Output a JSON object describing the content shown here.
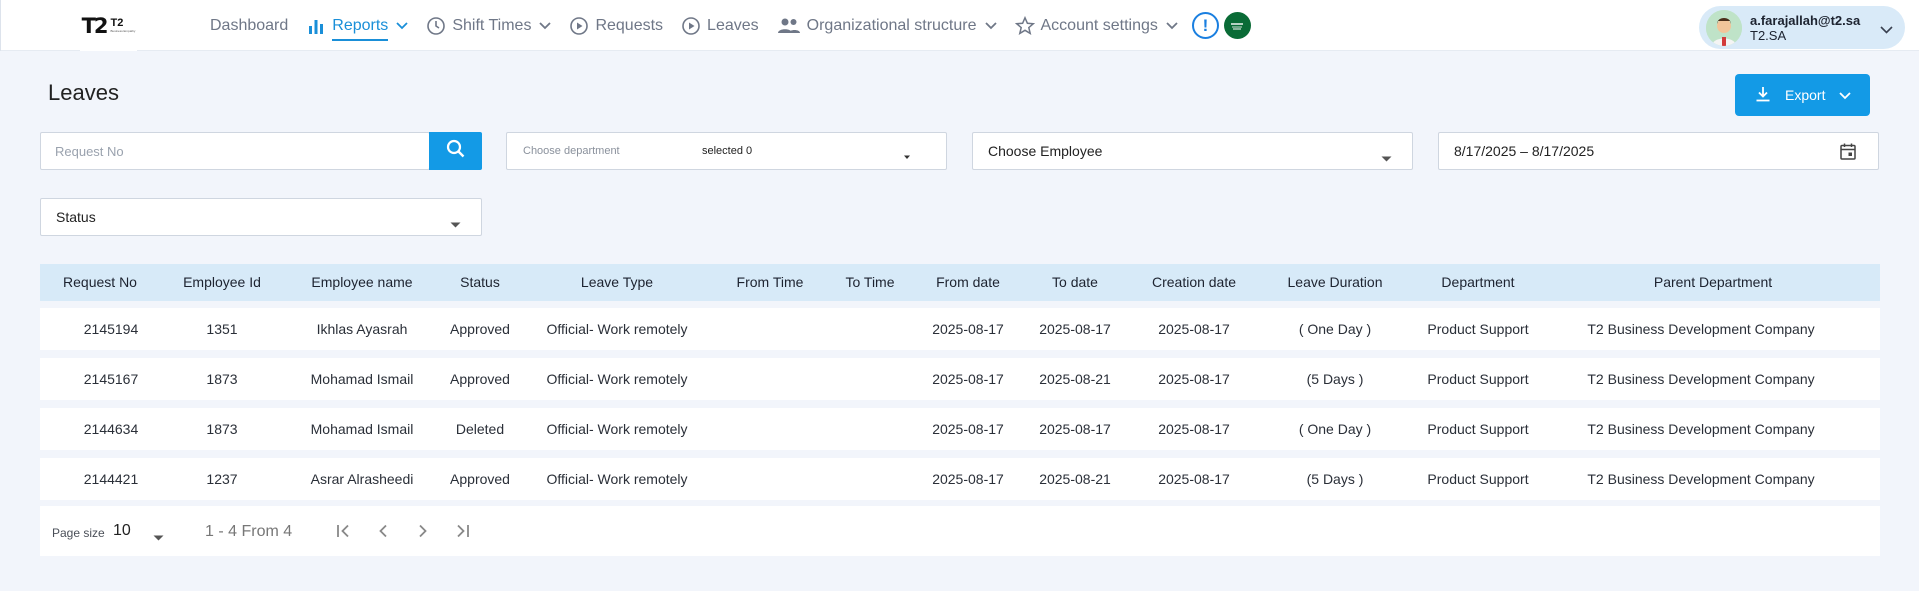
{
  "logo": {
    "mark": "T2",
    "brand": "T2",
    "tagline": "Business Empathy"
  },
  "nav": {
    "dashboard": "Dashboard",
    "reports": "Reports",
    "shift_times": "Shift Times",
    "requests": "Requests",
    "leaves": "Leaves",
    "org_structure": "Organizational structure",
    "account_settings": "Account settings"
  },
  "user": {
    "email": "a.farajallah@t2.sa",
    "org": "T2.SA"
  },
  "page": {
    "title": "Leaves",
    "export_label": "Export"
  },
  "filters": {
    "request_no_placeholder": "Request No",
    "department_placeholder": "Choose department",
    "department_selected": "selected 0",
    "employee": "Choose Employee",
    "date_range": "8/17/2025 – 8/17/2025",
    "status": "Status"
  },
  "table": {
    "headers": [
      "Request No",
      "Employee Id",
      "Employee name",
      "Status",
      "Leave Type",
      "From Time",
      "To Time",
      "From date",
      "To date",
      "Creation date",
      "Leave Duration",
      "Department",
      "Parent Department"
    ],
    "rows": [
      [
        "2145194",
        "1351",
        "Ikhlas Ayasrah",
        "Approved",
        "Official- Work remotely",
        "",
        "",
        "2025-08-17",
        "2025-08-17",
        "2025-08-17",
        "( One Day )",
        "Product Support",
        "T2 Business Development Company"
      ],
      [
        "2145167",
        "1873",
        "Mohamad Ismail",
        "Approved",
        "Official- Work remotely",
        "",
        "",
        "2025-08-17",
        "2025-08-21",
        "2025-08-17",
        "(5 Days )",
        "Product Support",
        "T2 Business Development Company"
      ],
      [
        "2144634",
        "1873",
        "Mohamad Ismail",
        "Deleted",
        "Official- Work remotely",
        "",
        "",
        "2025-08-17",
        "2025-08-17",
        "2025-08-17",
        "( One Day )",
        "Product Support",
        "T2 Business Development Company"
      ],
      [
        "2144421",
        "1237",
        "Asrar Alrasheedi",
        "Approved",
        "Official- Work remotely",
        "",
        "",
        "2025-08-17",
        "2025-08-21",
        "2025-08-17",
        "(5 Days )",
        "Product Support",
        "T2 Business Development Company"
      ]
    ]
  },
  "pager": {
    "page_size_label": "Page size",
    "page_size": "10",
    "range": "1 - 4 From 4"
  },
  "icons": {
    "reports": "bar-chart-icon",
    "shift_times": "clock-icon",
    "requests": "play-circle-icon",
    "leaves": "play-circle-icon",
    "org_structure": "people-icon",
    "account_settings": "star-icon",
    "alert": "exclamation-icon",
    "flag": "saudi-flag-icon"
  },
  "colors": {
    "accent": "#139ae6",
    "header_bg": "#d7eaf8",
    "page_bg": "#f2f5fb"
  }
}
